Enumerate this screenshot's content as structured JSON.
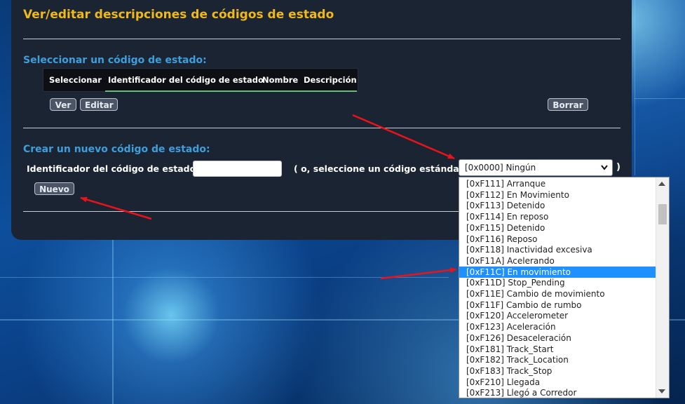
{
  "page": {
    "title": "Ver/editar descripciones de códigos de estado"
  },
  "select_section": {
    "title": "Seleccionar un código de estado:",
    "columns": [
      "Seleccionar",
      "Identificador del código de estado",
      "Nombre",
      "Descripción"
    ],
    "buttons": {
      "view": "Ver",
      "edit": "Editar",
      "delete": "Borrar"
    }
  },
  "create_section": {
    "title": "Crear un nuevo código de estado:",
    "id_label": "Identificador del código de estado:",
    "id_value": "",
    "standard_label": "( o, seleccione un código estándar:",
    "close_paren": ")",
    "selected_code": "[0x0000] Ningún",
    "new_button": "Nuevo"
  },
  "dropdown": {
    "options": [
      "[0xF111] Arranque",
      "[0xF112] En Movimiento",
      "[0xF113] Detenido",
      "[0xF114] En reposo",
      "[0xF115] Detenido",
      "[0xF116] Reposo",
      "[0xF118] Inactividad excesiva",
      "[0xF11A] Acelerando",
      "[0xF11C] En movimiento",
      "[0xF11D] Stop_Pending",
      "[0xF11E] Cambio de movimiento",
      "[0xF11F] Cambio de rumbo",
      "[0xF120] Accelerometer",
      "[0xF123] Aceleración",
      "[0xF126] Desaceleración",
      "[0xF181] Track_Start",
      "[0xF182] Track_Location",
      "[0xF183] Track_Stop",
      "[0xF210] Llegada",
      "[0xF213] Llegó a Corredor"
    ],
    "highlighted_index": 8
  },
  "colors": {
    "title": "#f0b818",
    "section_title": "#3d9fdc",
    "panel": "#1a2433",
    "highlight": "#1e90ff",
    "annotation_arrow": "#e8131b"
  }
}
